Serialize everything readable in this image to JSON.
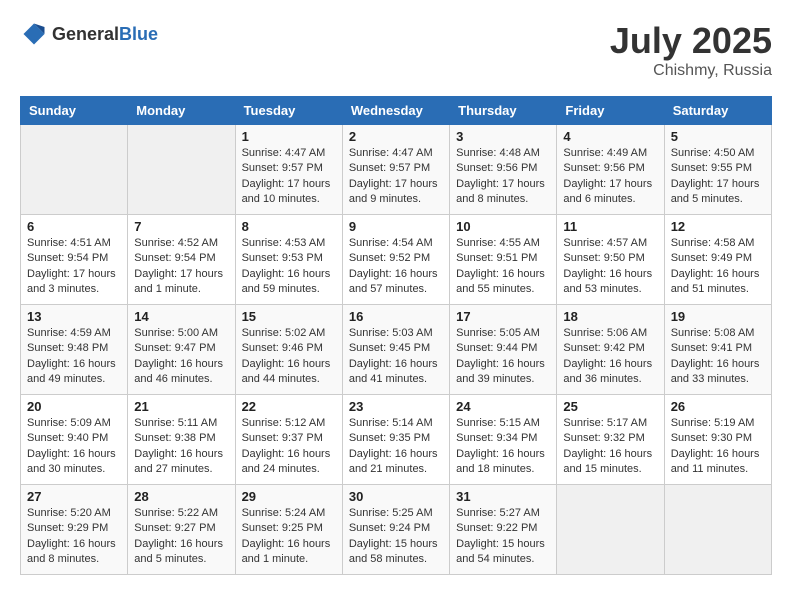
{
  "header": {
    "logo_general": "General",
    "logo_blue": "Blue",
    "title": "July 2025",
    "location": "Chishmy, Russia"
  },
  "weekdays": [
    "Sunday",
    "Monday",
    "Tuesday",
    "Wednesday",
    "Thursday",
    "Friday",
    "Saturday"
  ],
  "weeks": [
    [
      {
        "day": "",
        "info": ""
      },
      {
        "day": "",
        "info": ""
      },
      {
        "day": "1",
        "info": "Sunrise: 4:47 AM\nSunset: 9:57 PM\nDaylight: 17 hours and 10 minutes."
      },
      {
        "day": "2",
        "info": "Sunrise: 4:47 AM\nSunset: 9:57 PM\nDaylight: 17 hours and 9 minutes."
      },
      {
        "day": "3",
        "info": "Sunrise: 4:48 AM\nSunset: 9:56 PM\nDaylight: 17 hours and 8 minutes."
      },
      {
        "day": "4",
        "info": "Sunrise: 4:49 AM\nSunset: 9:56 PM\nDaylight: 17 hours and 6 minutes."
      },
      {
        "day": "5",
        "info": "Sunrise: 4:50 AM\nSunset: 9:55 PM\nDaylight: 17 hours and 5 minutes."
      }
    ],
    [
      {
        "day": "6",
        "info": "Sunrise: 4:51 AM\nSunset: 9:54 PM\nDaylight: 17 hours and 3 minutes."
      },
      {
        "day": "7",
        "info": "Sunrise: 4:52 AM\nSunset: 9:54 PM\nDaylight: 17 hours and 1 minute."
      },
      {
        "day": "8",
        "info": "Sunrise: 4:53 AM\nSunset: 9:53 PM\nDaylight: 16 hours and 59 minutes."
      },
      {
        "day": "9",
        "info": "Sunrise: 4:54 AM\nSunset: 9:52 PM\nDaylight: 16 hours and 57 minutes."
      },
      {
        "day": "10",
        "info": "Sunrise: 4:55 AM\nSunset: 9:51 PM\nDaylight: 16 hours and 55 minutes."
      },
      {
        "day": "11",
        "info": "Sunrise: 4:57 AM\nSunset: 9:50 PM\nDaylight: 16 hours and 53 minutes."
      },
      {
        "day": "12",
        "info": "Sunrise: 4:58 AM\nSunset: 9:49 PM\nDaylight: 16 hours and 51 minutes."
      }
    ],
    [
      {
        "day": "13",
        "info": "Sunrise: 4:59 AM\nSunset: 9:48 PM\nDaylight: 16 hours and 49 minutes."
      },
      {
        "day": "14",
        "info": "Sunrise: 5:00 AM\nSunset: 9:47 PM\nDaylight: 16 hours and 46 minutes."
      },
      {
        "day": "15",
        "info": "Sunrise: 5:02 AM\nSunset: 9:46 PM\nDaylight: 16 hours and 44 minutes."
      },
      {
        "day": "16",
        "info": "Sunrise: 5:03 AM\nSunset: 9:45 PM\nDaylight: 16 hours and 41 minutes."
      },
      {
        "day": "17",
        "info": "Sunrise: 5:05 AM\nSunset: 9:44 PM\nDaylight: 16 hours and 39 minutes."
      },
      {
        "day": "18",
        "info": "Sunrise: 5:06 AM\nSunset: 9:42 PM\nDaylight: 16 hours and 36 minutes."
      },
      {
        "day": "19",
        "info": "Sunrise: 5:08 AM\nSunset: 9:41 PM\nDaylight: 16 hours and 33 minutes."
      }
    ],
    [
      {
        "day": "20",
        "info": "Sunrise: 5:09 AM\nSunset: 9:40 PM\nDaylight: 16 hours and 30 minutes."
      },
      {
        "day": "21",
        "info": "Sunrise: 5:11 AM\nSunset: 9:38 PM\nDaylight: 16 hours and 27 minutes."
      },
      {
        "day": "22",
        "info": "Sunrise: 5:12 AM\nSunset: 9:37 PM\nDaylight: 16 hours and 24 minutes."
      },
      {
        "day": "23",
        "info": "Sunrise: 5:14 AM\nSunset: 9:35 PM\nDaylight: 16 hours and 21 minutes."
      },
      {
        "day": "24",
        "info": "Sunrise: 5:15 AM\nSunset: 9:34 PM\nDaylight: 16 hours and 18 minutes."
      },
      {
        "day": "25",
        "info": "Sunrise: 5:17 AM\nSunset: 9:32 PM\nDaylight: 16 hours and 15 minutes."
      },
      {
        "day": "26",
        "info": "Sunrise: 5:19 AM\nSunset: 9:30 PM\nDaylight: 16 hours and 11 minutes."
      }
    ],
    [
      {
        "day": "27",
        "info": "Sunrise: 5:20 AM\nSunset: 9:29 PM\nDaylight: 16 hours and 8 minutes."
      },
      {
        "day": "28",
        "info": "Sunrise: 5:22 AM\nSunset: 9:27 PM\nDaylight: 16 hours and 5 minutes."
      },
      {
        "day": "29",
        "info": "Sunrise: 5:24 AM\nSunset: 9:25 PM\nDaylight: 16 hours and 1 minute."
      },
      {
        "day": "30",
        "info": "Sunrise: 5:25 AM\nSunset: 9:24 PM\nDaylight: 15 hours and 58 minutes."
      },
      {
        "day": "31",
        "info": "Sunrise: 5:27 AM\nSunset: 9:22 PM\nDaylight: 15 hours and 54 minutes."
      },
      {
        "day": "",
        "info": ""
      },
      {
        "day": "",
        "info": ""
      }
    ]
  ]
}
